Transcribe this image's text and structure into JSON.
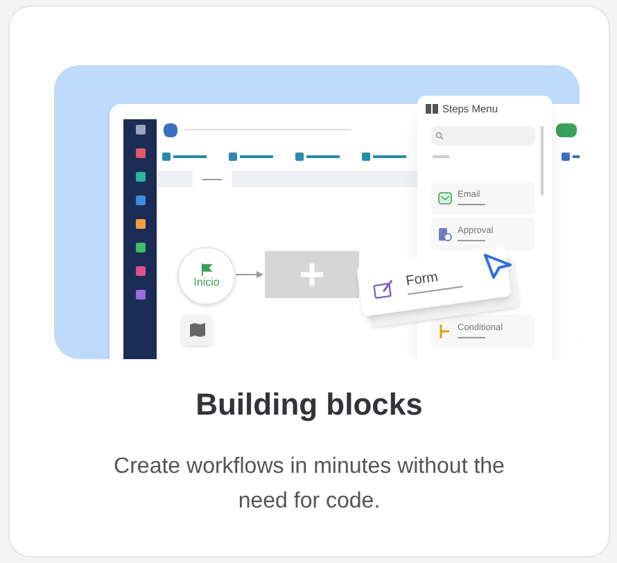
{
  "illustration": {
    "sidebar_icons": [
      {
        "color": "#9aa5c4"
      },
      {
        "color": "#e05a6b"
      },
      {
        "color": "#2bb3a3"
      },
      {
        "color": "#3d8be0"
      },
      {
        "color": "#f0a040"
      },
      {
        "color": "#3fbf6a"
      },
      {
        "color": "#e0508f"
      },
      {
        "color": "#9b6be0"
      }
    ],
    "start_node": {
      "label": "Inicio"
    },
    "steps_menu": {
      "title": "Steps Menu",
      "items": [
        {
          "label": "Email",
          "kind": "email"
        },
        {
          "label": "Approval",
          "kind": "approval"
        },
        {
          "label": "Conditional",
          "kind": "conditional"
        }
      ]
    },
    "dragged_step": {
      "label": "Form"
    }
  },
  "title": "Building blocks",
  "description": "Create workflows in minutes without the need for code."
}
